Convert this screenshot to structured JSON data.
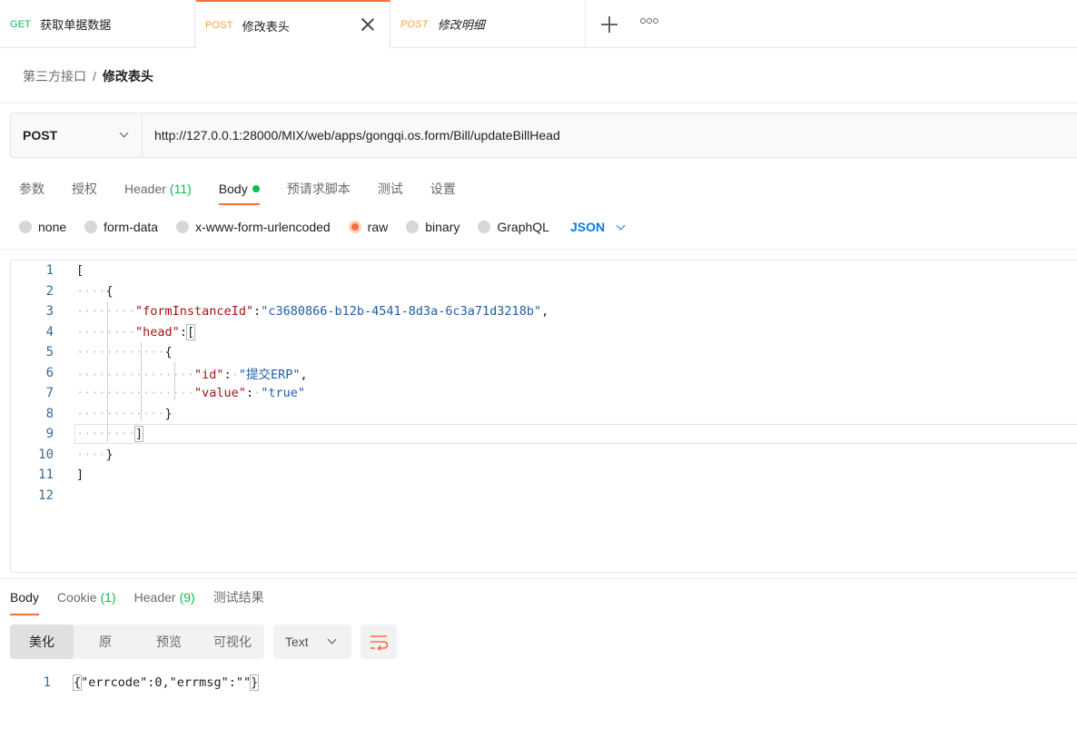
{
  "tabs": [
    {
      "method": "GET",
      "title": "获取单据数据"
    },
    {
      "method": "POST",
      "title": "修改表头"
    },
    {
      "method": "POST",
      "title": "修改明细"
    }
  ],
  "breadcrumb": {
    "parent": "第三方接口",
    "separator": "/",
    "current": "修改表头"
  },
  "request": {
    "method": "POST",
    "url": "http://127.0.0.1:28000/MIX/web/apps/gongqi.os.form/Bill/updateBillHead"
  },
  "request_tabs": {
    "params": "参数",
    "auth": "授权",
    "header_label": "Header",
    "header_count": "(11)",
    "body": "Body",
    "pre_script": "预请求脚本",
    "tests": "测试",
    "settings": "设置"
  },
  "body_types": {
    "none": "none",
    "form_data": "form-data",
    "urlencoded": "x-www-form-urlencoded",
    "raw": "raw",
    "binary": "binary",
    "graphql": "GraphQL",
    "language": "JSON",
    "selected": "raw"
  },
  "editor": {
    "line_numbers": [
      "1",
      "2",
      "3",
      "4",
      "5",
      "6",
      "7",
      "8",
      "9",
      "10",
      "11",
      "12"
    ],
    "key_formInstanceId": "\"formInstanceId\"",
    "val_formInstanceId": "\"c3680866-b12b-4541-8d3a-6c3a71d3218b\"",
    "key_head": "\"head\"",
    "key_id": "\"id\"",
    "val_id": "\"提交ERP\"",
    "key_value": "\"value\"",
    "val_value": "\"true\""
  },
  "response": {
    "tabs": {
      "body": "Body",
      "cookie_label": "Cookie",
      "cookie_count": "(1)",
      "header_label": "Header",
      "header_count": "(9)",
      "test_results": "测试结果"
    },
    "views": [
      "美化",
      "原",
      "预览",
      "可视化"
    ],
    "active_view": "美化",
    "format": "Text",
    "line_number": "1",
    "content": "\"errcode\":0,\"errmsg\":\"\""
  },
  "colors": {
    "accent": "#ff6c37",
    "get": "#0cbb52",
    "post": "#f7a43f",
    "json_blue": "#097bed"
  }
}
